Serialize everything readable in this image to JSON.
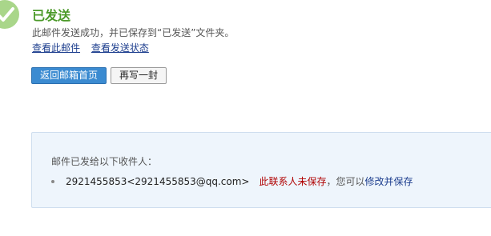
{
  "header": {
    "title": "已发送",
    "description": "此邮件发送成功，并已保存到“已发送”文件夹。",
    "links": [
      "查看此邮件",
      "查看发送状态"
    ]
  },
  "buttons": {
    "back_home": "返回邮箱首页",
    "write_again": "再写一封"
  },
  "recipients_panel": {
    "heading": "邮件已发给以下收件人：",
    "recipients": [
      {
        "address": "2921455853<2921455853@qq.com>",
        "status": "此联系人未保存",
        "hint": "，您可以",
        "save_link": "修改并保存"
      }
    ]
  },
  "colors": {
    "success_green": "#4c9a2a",
    "primary_blue": "#3b8bd1",
    "warning_red": "#b00000",
    "panel_bg": "#eef5fc"
  }
}
